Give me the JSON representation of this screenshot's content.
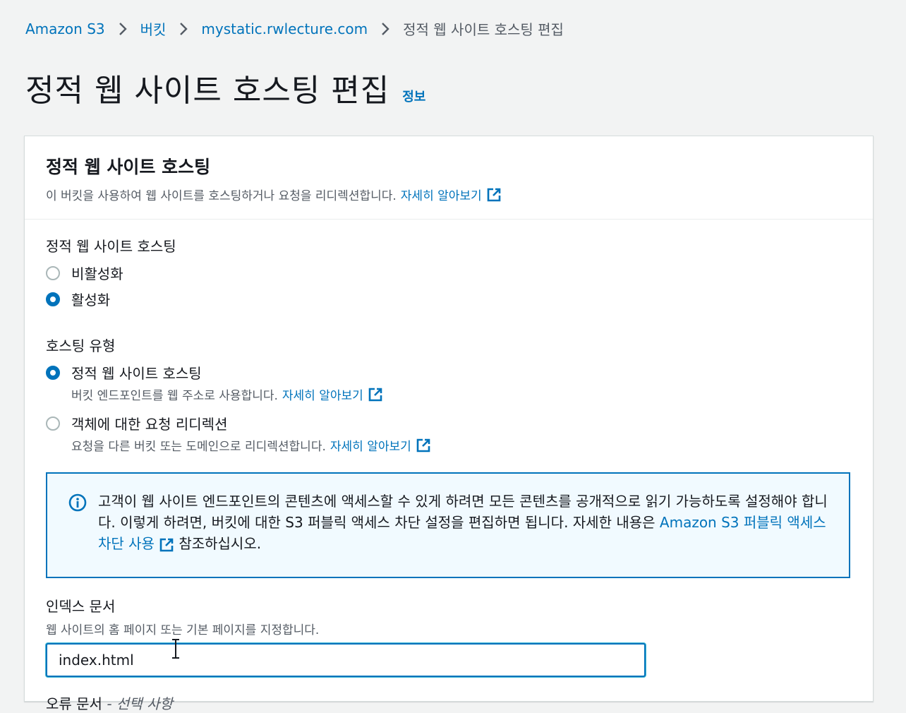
{
  "breadcrumb": {
    "items": [
      {
        "label": "Amazon S3"
      },
      {
        "label": "버킷"
      },
      {
        "label": "mystatic.rwlecture.com"
      }
    ],
    "current": "정적 웹 사이트 호스팅 편집"
  },
  "page": {
    "title": "정적 웹 사이트 호스팅 편집",
    "info_link": "정보"
  },
  "panel": {
    "title": "정적 웹 사이트 호스팅",
    "description": "이 버킷을 사용하여 웹 사이트를 호스팅하거나 요청을 리디렉션합니다.",
    "learn_more": "자세히 알아보기"
  },
  "hosting": {
    "label": "정적 웹 사이트 호스팅",
    "options": [
      {
        "label": "비활성화",
        "checked": false
      },
      {
        "label": "활성화",
        "checked": true
      }
    ]
  },
  "hosting_type": {
    "label": "호스팅 유형",
    "options": [
      {
        "label": "정적 웹 사이트 호스팅",
        "description": "버킷 엔드포인트를 웹 주소로 사용합니다.",
        "learn_more": "자세히 알아보기",
        "checked": true
      },
      {
        "label": "객체에 대한 요청 리디렉션",
        "description": "요청을 다른 버킷 또는 도메인으로 리디렉션합니다.",
        "learn_more": "자세히 알아보기",
        "checked": false
      }
    ]
  },
  "alert": {
    "text": "고객이 웹 사이트 엔드포인트의 콘텐츠에 액세스할 수 있게 하려면 모든 콘텐츠를 공개적으로 읽기 가능하도록 설정해야 합니다. 이렇게 하려면, 버킷에 대한 S3 퍼블릭 액세스 차단 설정을 편집하면 됩니다. 자세한 내용은",
    "link": "Amazon S3 퍼블릭 액세스 차단 사용",
    "suffix": "참조하십시오."
  },
  "index_document": {
    "label": "인덱스 문서",
    "description": "웹 사이트의 홈 페이지 또는 기본 페이지를 지정합니다.",
    "value": "index.html"
  },
  "error_document": {
    "label": "오류 문서",
    "optional": "- 선택 사항"
  },
  "colors": {
    "link": "#0073bb",
    "background": "#f2f3f3",
    "alert_background": "#f1faff"
  }
}
